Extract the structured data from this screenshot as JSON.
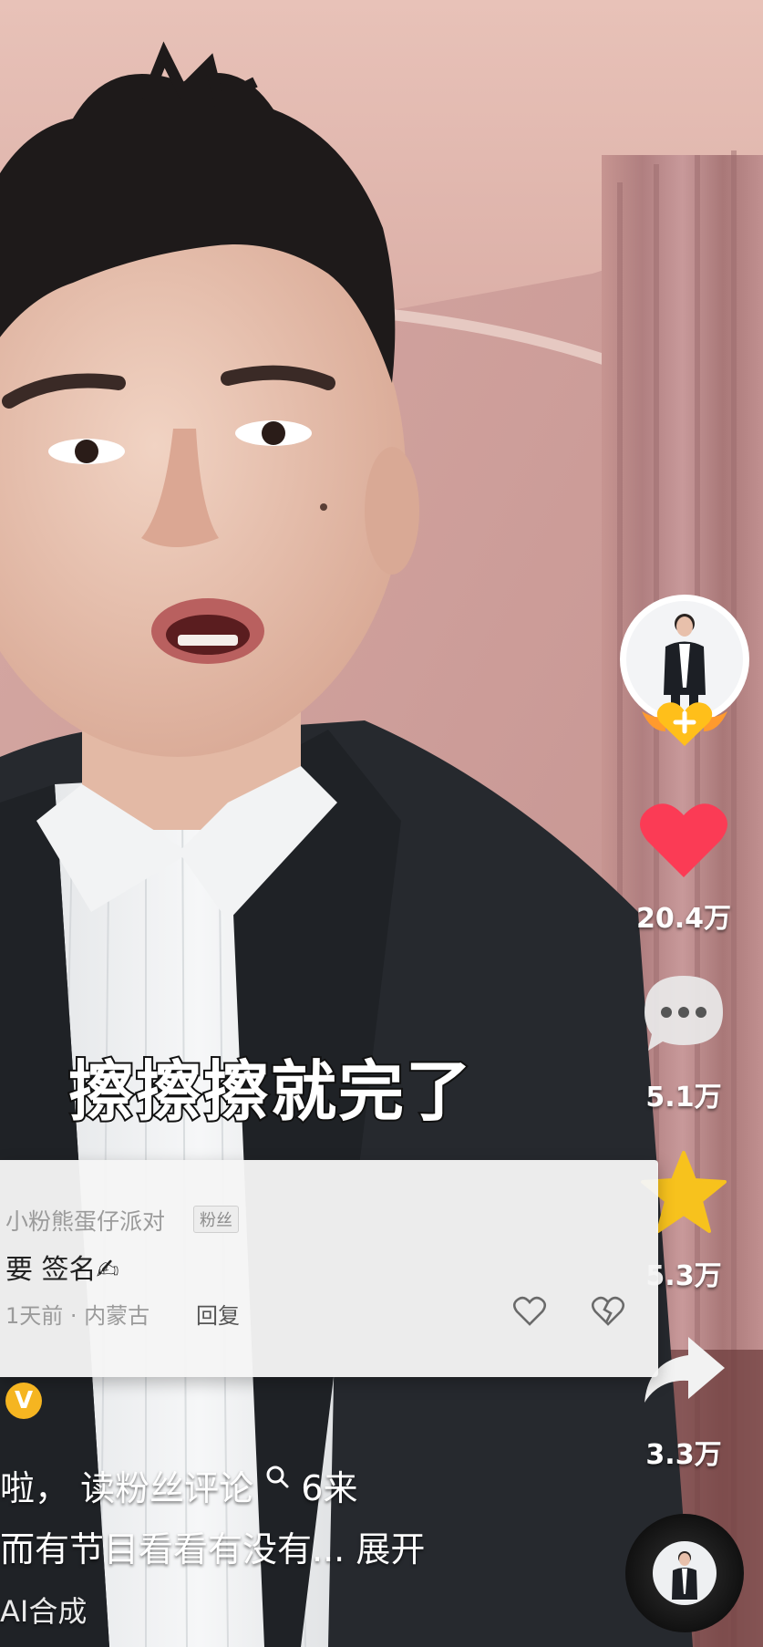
{
  "video": {
    "subtitle": "擦擦擦就完了"
  },
  "sidebar": {
    "like_count": "20.4万",
    "comment_count": "5.1万",
    "favorite_count": "5.3万",
    "share_count": "3.3万"
  },
  "comment": {
    "username": "小粉熊蛋仔派对",
    "badge": "粉丝",
    "text": "要 签名✍",
    "meta": "1天前 · 内蒙古",
    "reply_label": "回复"
  },
  "caption": {
    "badge_letter": "V",
    "line1": "啦， 读粉丝评论",
    "line1_suffix": "6来",
    "line2": "而有节目看看有没有...",
    "expand": "展开",
    "ai_label": "AI合成"
  },
  "colors": {
    "like_red": "#fb3b55",
    "star_gold": "#f7c21d",
    "follow_gold": "#ffb400"
  }
}
